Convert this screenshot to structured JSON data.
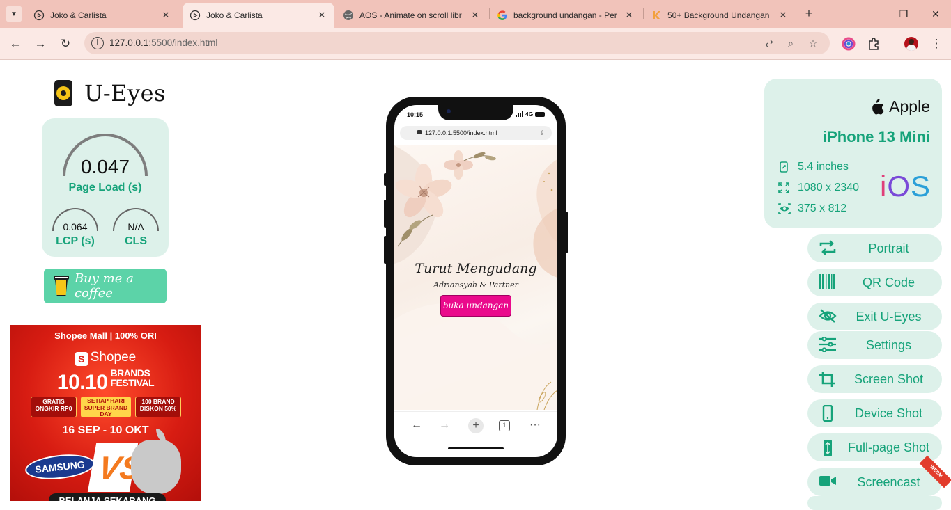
{
  "browser": {
    "tabs": [
      {
        "title": "Joko & Carlista",
        "active": false
      },
      {
        "title": "Joko & Carlista",
        "active": true
      },
      {
        "title": "AOS - Animate on scroll libr",
        "active": false
      },
      {
        "title": "background undangan - Per",
        "active": false
      },
      {
        "title": "50+ Background Undangan",
        "active": false
      }
    ],
    "url_host": "127.0.0.1",
    "url_rest": ":5500/index.html"
  },
  "app": {
    "name": "U-Eyes",
    "metrics": {
      "page_load_value": "0.047",
      "page_load_label": "Page Load (s)",
      "lcp_value": "0.064",
      "lcp_label": "LCP (s)",
      "cls_value": "N/A",
      "cls_label": "CLS"
    },
    "coffee_label": "Buy me a coffee"
  },
  "ad": {
    "top": "Shopee Mall | 100% ORI",
    "brand": "Shopee",
    "big": "10.10",
    "big_sub_1": "BRANDS",
    "big_sub_2": "FESTIVAL",
    "pill_1": "GRATIS ONGKIR RP0",
    "pill_2": "SETIAP HARI SUPER BRAND DAY",
    "pill_3": "100 BRAND DISKON 50%",
    "date": "16 SEP - 10 OKT",
    "samsung": "SAMSUNG",
    "cta": "BELANJA SEKARANG"
  },
  "phone": {
    "status_time": "10:15",
    "status_network": "4G",
    "url": "127.0.0.1:5500/index.html",
    "title": "Turut Mengudang",
    "subtitle": "Adriansyah & Partner",
    "button": "buka undangan",
    "tab_count": "1"
  },
  "device": {
    "brand": "Apple",
    "model": "iPhone 13 Mini",
    "size": "5.4 inches",
    "resolution": "1080 x 2340",
    "viewport": "375 x 812",
    "os": "iOS"
  },
  "actions": [
    {
      "label": "Portrait",
      "icon": "rotate-icon"
    },
    {
      "label": "QR Code",
      "icon": "barcode-icon"
    },
    {
      "label": "Exit U-Eyes",
      "icon": "eye-off-icon"
    },
    {
      "label": "Settings",
      "icon": "sliders-icon"
    },
    {
      "label": "Screen Shot",
      "icon": "crop-icon"
    },
    {
      "label": "Device Shot",
      "icon": "phone-icon"
    },
    {
      "label": "Full-page Shot",
      "icon": "fullpage-icon"
    },
    {
      "label": "Screencast",
      "icon": "video-icon"
    }
  ],
  "ribbon": "WEBM",
  "colors": {
    "accent": "#16a37a",
    "card": "#ddf1ea",
    "tabstrip": "#f1c3ba",
    "invite_button": "#ea0a8c"
  }
}
